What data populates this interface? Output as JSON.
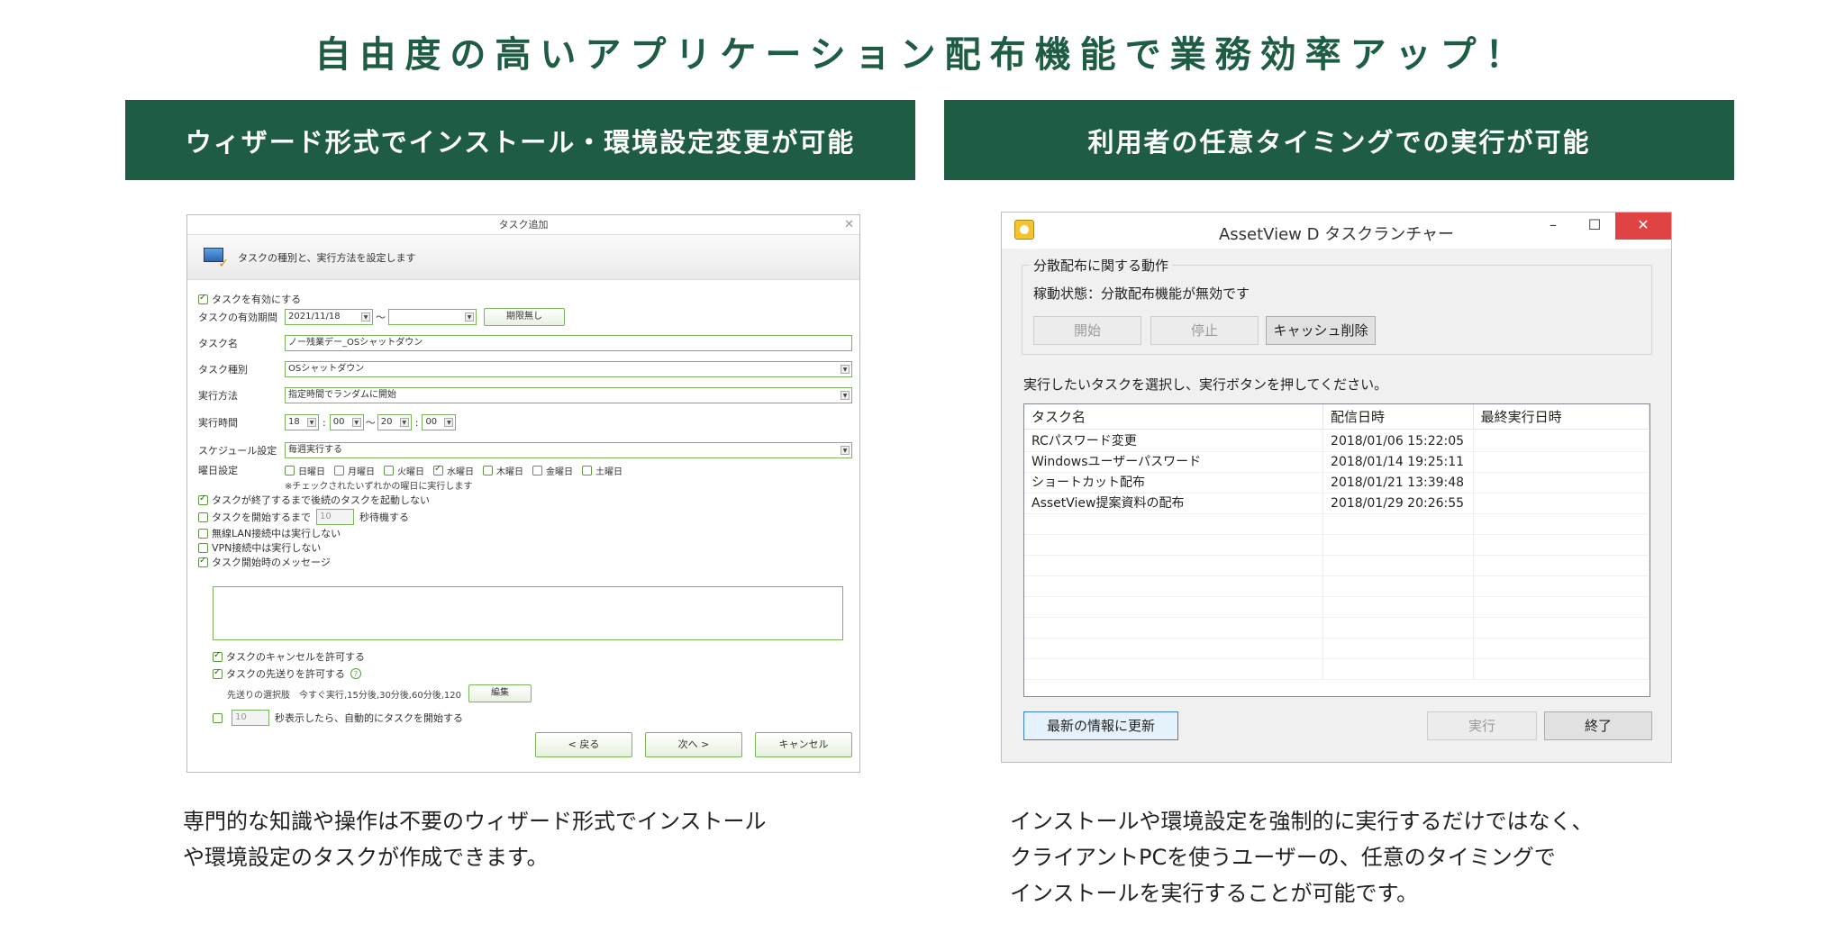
{
  "headline": "自由度の高いアプリケーション配布機能で業務効率アップ！",
  "left_panel": {
    "banner": "ウィザード形式でインストール・環境設定変更が可能",
    "desc_line1": "専門的な知識や操作は不要のウィザード形式でインストール",
    "desc_line2": "や環境設定のタスクが作成できます。",
    "window": {
      "title": "タスク追加",
      "subtitle": "タスクの種別と、実行方法を設定します",
      "enable_task": "タスクを有効にする",
      "validity_label": "タスクの有効期間",
      "validity_from": "2021/11/18",
      "validity_sep": "～",
      "no_limit_button": "期限無し",
      "task_name_label": "タスク名",
      "task_name_value": "ノー残業デー_OSシャットダウン",
      "task_type_label": "タスク種別",
      "task_type_value": "OSシャットダウン",
      "method_label": "実行方法",
      "method_value": "指定時間でランダムに開始",
      "time_label": "実行時間",
      "time_h1": "18",
      "time_m1": "00",
      "time_tilde": "～",
      "time_h2": "20",
      "time_m2": "00",
      "colon": ":",
      "schedule_label": "スケジュール設定",
      "schedule_value": "毎週実行する",
      "weekday_label": "曜日設定",
      "days": [
        "日曜日",
        "月曜日",
        "火曜日",
        "水曜日",
        "木曜日",
        "金曜日",
        "土曜日"
      ],
      "day_note": "※チェックされたいずれかの曜日に実行します",
      "opt_wait_finish": "タスクが終了するまで後続のタスクを起動しない",
      "opt_wait_start_pre": "タスクを開始するまで",
      "opt_wait_start_value": "10",
      "opt_wait_start_post": "秒待機する",
      "opt_wlan": "無線LAN接続中は実行しない",
      "opt_vpn": "VPN接続中は実行しない",
      "opt_message": "タスク開始時のメッセージ",
      "opt_cancel": "タスクのキャンセルを許可する",
      "opt_postpone": "タスクの先送りを許可する",
      "help_mark": "?",
      "postpone_choices": "先送りの選択肢　今すぐ実行,15分後,30分後,60分後,120",
      "edit_button": "編集",
      "auto_start_value": "10",
      "auto_start_text": "秒表示したら、自動的にタスクを開始する",
      "back_button": "< 戻る",
      "next_button": "次へ >",
      "cancel_button": "キャンセル"
    }
  },
  "right_panel": {
    "banner": "利用者の任意タイミングでの実行が可能",
    "desc_line1": "インストールや環境設定を強制的に実行するだけではなく、",
    "desc_line2": "クライアントPCを使うユーザーの、任意のタイミングで",
    "desc_line3": "インストールを実行することが可能です。",
    "window": {
      "title": "AssetView D タスクランチャー",
      "min_glyph": "–",
      "max_glyph": "☐",
      "close_glyph": "✕",
      "group_title": "分散配布に関する動作",
      "status_text": "稼動状態：分散配布機能が無効です",
      "start_button": "開始",
      "stop_button": "停止",
      "clear_cache_button": "キャッシュ削除",
      "instruction": "実行したいタスクを選択し、実行ボタンを押してください。",
      "columns": [
        "タスク名",
        "配信日時",
        "最終実行日時"
      ],
      "rows": [
        {
          "name": "RCパスワード変更",
          "date": "2018/01/06 15:22:05",
          "last": ""
        },
        {
          "name": "Windowsユーザーパスワード",
          "date": "2018/01/14 19:25:11",
          "last": ""
        },
        {
          "name": "ショートカット配布",
          "date": "2018/01/21 13:39:48",
          "last": ""
        },
        {
          "name": "AssetView提案資料の配布",
          "date": "2018/01/29 20:26:55",
          "last": ""
        }
      ],
      "refresh_button": "最新の情報に更新",
      "run_button": "実行",
      "exit_button": "終了"
    }
  }
}
